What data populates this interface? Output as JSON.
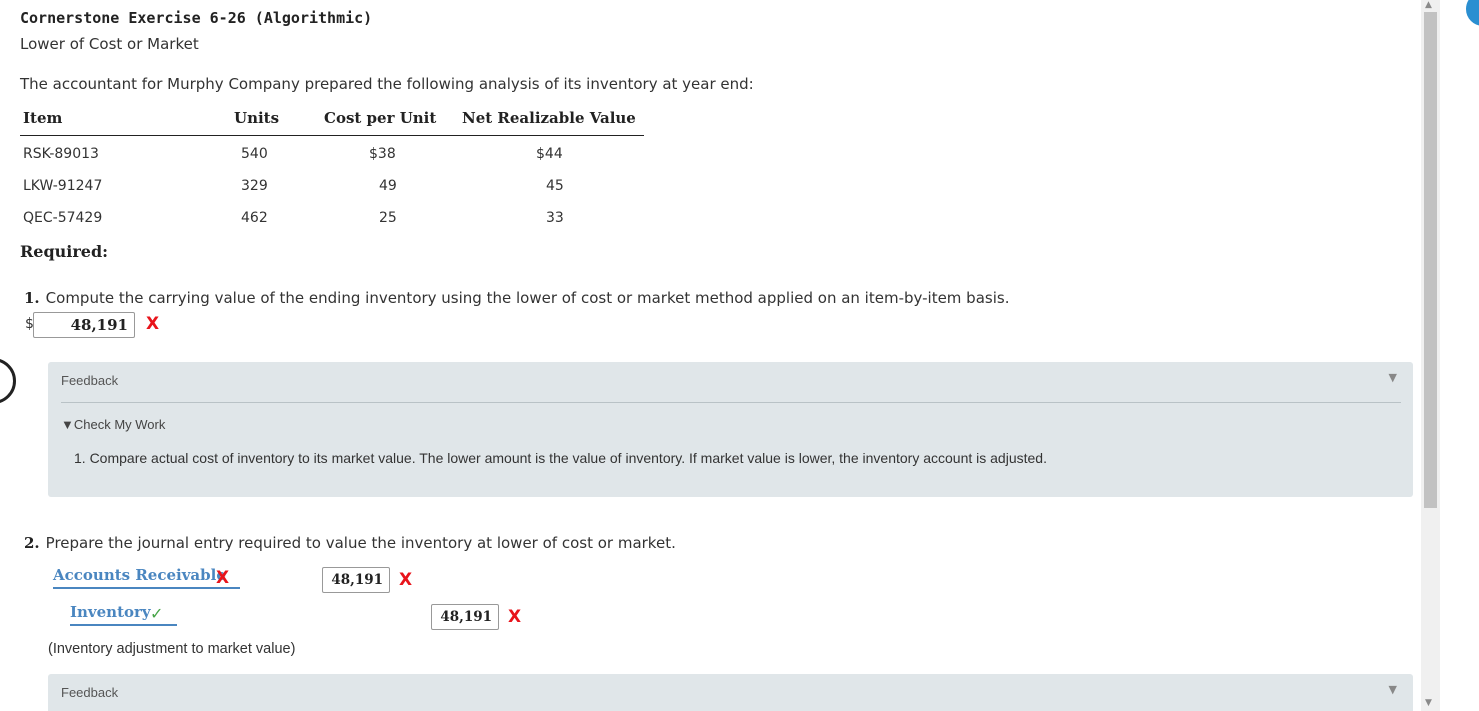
{
  "header": {
    "title": "Cornerstone Exercise 6-26 (Algorithmic)",
    "subtitle": "Lower of Cost or Market"
  },
  "intro": "The accountant for Murphy Company prepared the following analysis of its inventory at year end:",
  "inventory_table": {
    "headers": [
      "Item",
      "Units",
      "Cost per Unit",
      "Net Realizable Value"
    ],
    "rows": [
      [
        "RSK-89013",
        "540",
        "$38",
        "$44"
      ],
      [
        "LKW-91247",
        "329",
        "49",
        "45"
      ],
      [
        "QEC-57429",
        "462",
        "25",
        "33"
      ]
    ]
  },
  "required_label": "Required:",
  "q1": {
    "number": "1.",
    "text": "Compute the carrying value of the ending inventory using the lower of cost or market method applied on an item-by-item basis.",
    "currency": "$",
    "answer": "48,191",
    "mark": "X"
  },
  "feedback1": {
    "label": "Feedback",
    "toggle": "▼",
    "check_label": "▼Check My Work",
    "text": "1. Compare actual cost of inventory to its market value. The lower amount is the value of inventory. If market value is lower, the inventory account is adjusted."
  },
  "q2": {
    "number": "2.",
    "text": "Prepare the journal entry required to value the inventory at lower of cost or market.",
    "debit_account": "Accounts Receivable",
    "debit_mark": "X",
    "debit_amount": "48,191",
    "debit_amount_mark": "X",
    "credit_account": "Inventory",
    "credit_mark": "✓",
    "credit_amount": "48,191",
    "credit_amount_mark": "X",
    "memo": "(Inventory adjustment to market value)"
  },
  "feedback2": {
    "label": "Feedback",
    "toggle": "▼"
  },
  "scrollbar": {
    "up_arrow": "▲",
    "down_arrow": "▼"
  },
  "colors": {
    "feedback_bg": "#e0e6e9",
    "error_red": "#e8141b",
    "correct_green": "#47a447",
    "account_link_blue": "#4a86c0"
  }
}
